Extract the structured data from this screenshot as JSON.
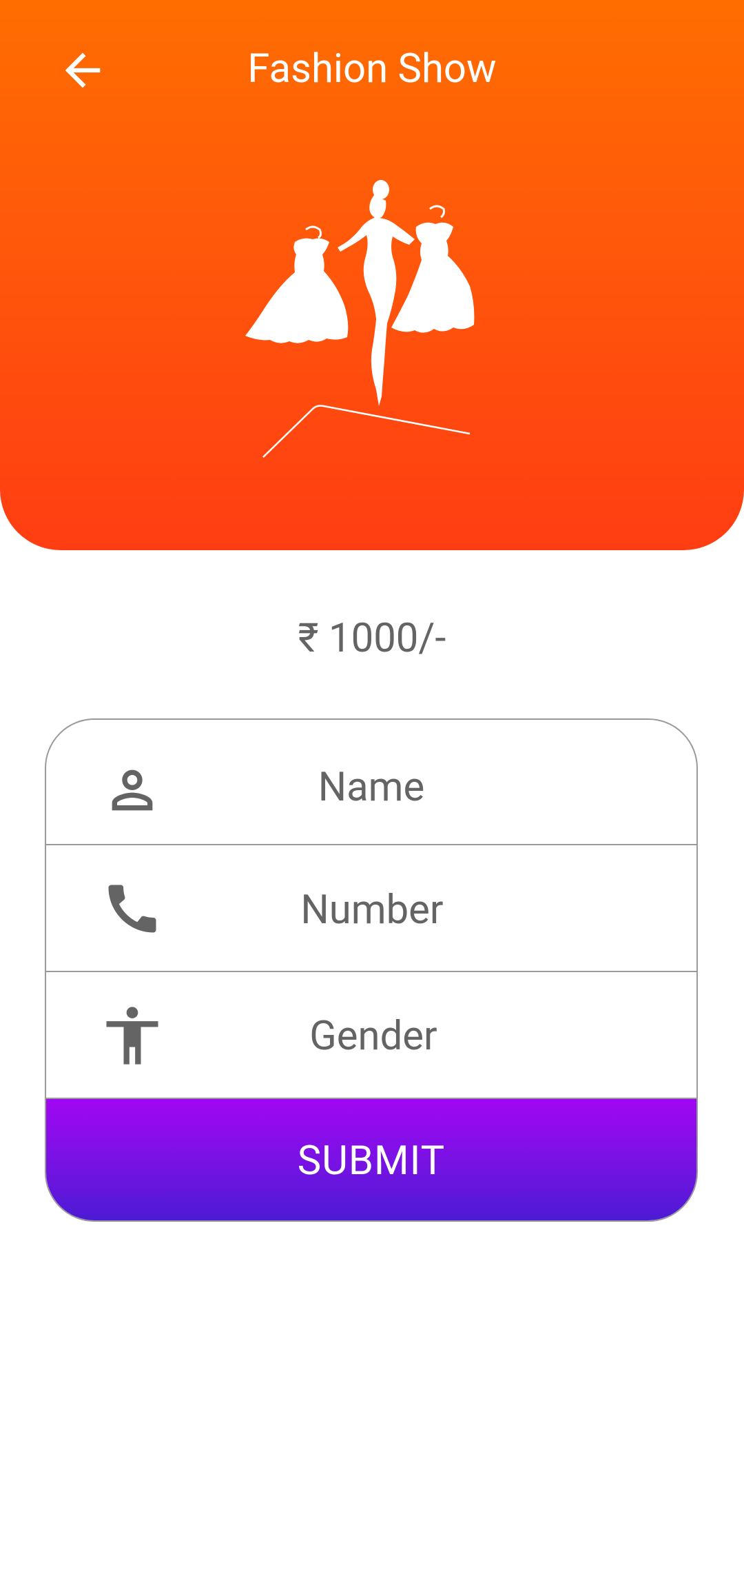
{
  "header": {
    "title": "Fashion Show",
    "back_icon": "arrow-back-icon",
    "hero_icon": "fashion-show-illustration",
    "gradient_top": "#ff6d00",
    "gradient_bottom": "#ff3d12"
  },
  "price": "₹ 1000/-",
  "form": {
    "fields": [
      {
        "icon": "person-icon",
        "placeholder": "Name"
      },
      {
        "icon": "phone-icon",
        "placeholder": "Number"
      },
      {
        "icon": "accessibility-icon",
        "placeholder": "Gender"
      }
    ],
    "submit_label": "SUBMIT",
    "submit_gradient_top": "#a107f3",
    "submit_gradient_bottom": "#4a1bd3"
  }
}
